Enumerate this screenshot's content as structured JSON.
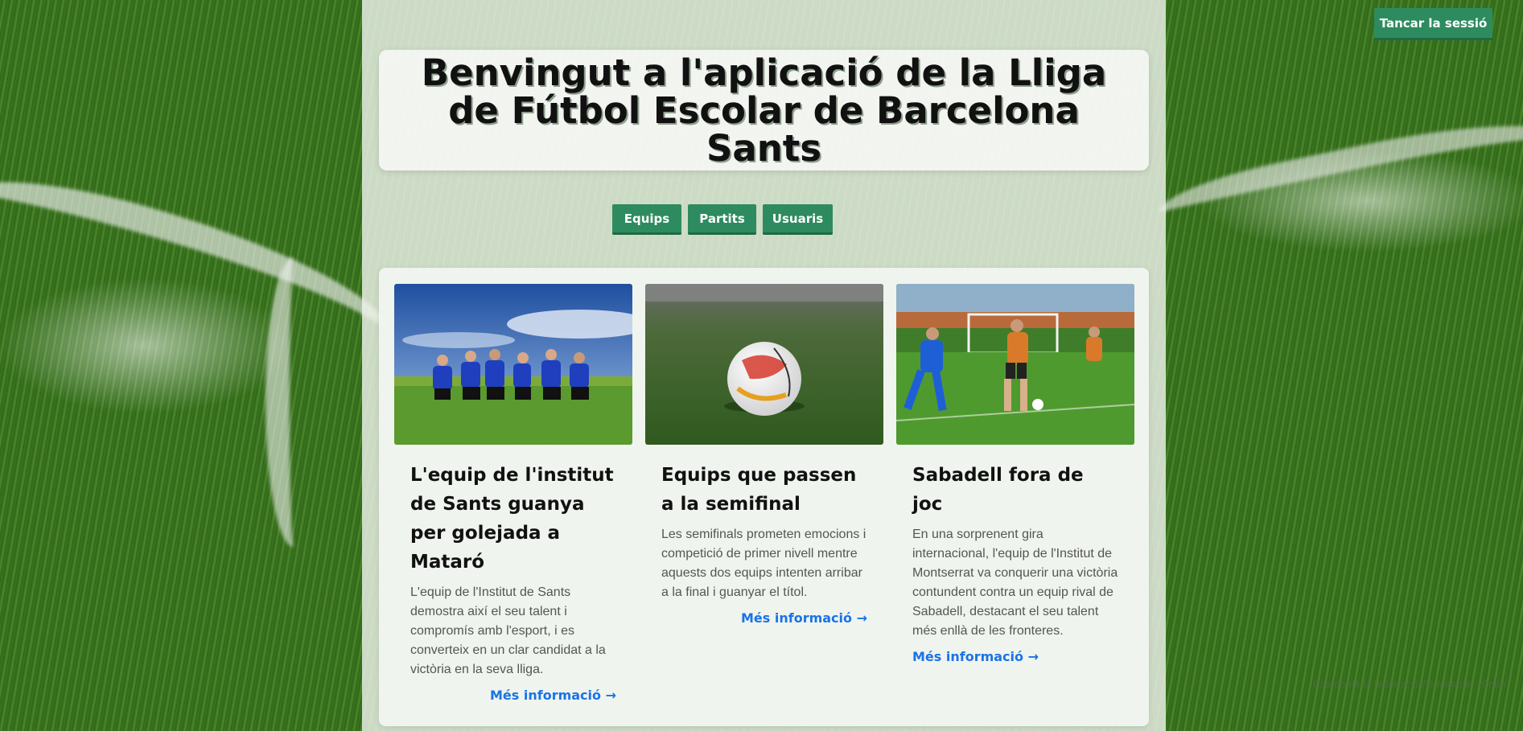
{
  "header": {
    "title": "Benvingut a l'aplicació de la Lliga de Fútbol Escolar de Barcelona Sants"
  },
  "top_bar": {
    "logout_label": "Tancar la sessió"
  },
  "nav": {
    "items": [
      {
        "label": "Equips"
      },
      {
        "label": "Partits"
      },
      {
        "label": "Usuaris"
      }
    ]
  },
  "news": {
    "cards": [
      {
        "title": "L'equip de l'institut de Sants guanya per golejada a Mataró",
        "text": "L'equip de l'Institut de Sants demostra així el seu talent i compromís amb l'esport, i es converteix en un clar candidat a la victòria en la seva lliga.",
        "link": "Més informació →"
      },
      {
        "title": "Equips que passen a la semifinal",
        "text": "Les semifinals prometen emocions i competició de primer nivell mentre aquests dos equips intenten arribar a la final i guanyar el títol.",
        "link": "Més informació →"
      },
      {
        "title": "Sabadell fora de joc",
        "text": "En una sorprenent gira internacional, l'equip de l'Institut de Montserrat va conquerir una victòria contundent contra un equip rival de Sabadell, destacant el seu talent més enllà de les fronteres.",
        "link": "Més informació →"
      }
    ]
  },
  "system": {
    "battery_status": "Estado de la batería: 63% restante 20min"
  },
  "colors": {
    "accent": "#2e8b5f",
    "link": "#1a73e8"
  }
}
